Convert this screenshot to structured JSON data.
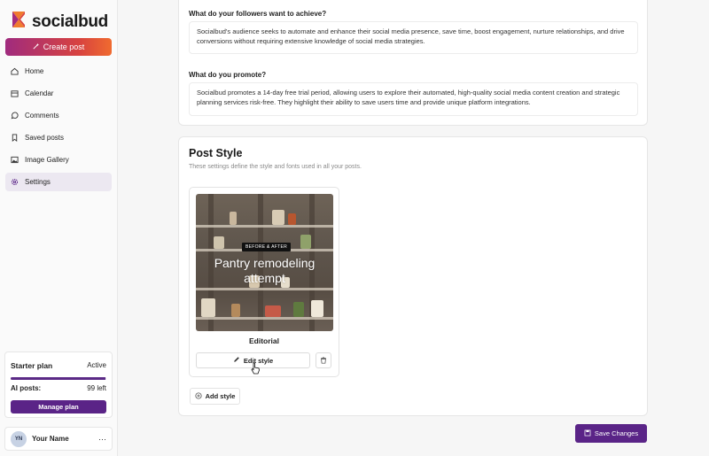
{
  "brand": {
    "name": "socialbud",
    "accent": "#5a2487",
    "gradient": [
      "#a02b7e",
      "#f06b2f"
    ]
  },
  "sidebar": {
    "create_label": "Create post",
    "items": [
      {
        "label": "Home",
        "icon": "home-icon"
      },
      {
        "label": "Calendar",
        "icon": "calendar-icon"
      },
      {
        "label": "Comments",
        "icon": "comment-icon"
      },
      {
        "label": "Saved posts",
        "icon": "bookmark-icon"
      },
      {
        "label": "Image Gallery",
        "icon": "image-icon"
      },
      {
        "label": "Settings",
        "icon": "gear-icon",
        "active": true
      }
    ]
  },
  "plan": {
    "name": "Starter plan",
    "status": "Active",
    "ai_label": "AI posts:",
    "ai_value": "99 left",
    "usage_fraction": 0.99,
    "manage_label": "Manage plan"
  },
  "user": {
    "initials": "YN",
    "name": "Your Name",
    "menu": "···"
  },
  "questions": [
    {
      "label": "What do your followers want to achieve?",
      "answer": "Socialbud's audience seeks to automate and enhance their social media presence, save time, boost engagement, nurture relationships, and drive conversions without requiring extensive knowledge of social media strategies."
    },
    {
      "label": "What do you promote?",
      "answer": "Socialbud promotes a 14-day free trial period, allowing users to explore their automated, high-quality social media content creation and strategic planning services risk-free. They highlight their ability to save users time and provide unique platform integrations."
    }
  ],
  "post_style": {
    "title": "Post Style",
    "subtitle": "These settings define the style and fonts used in all your posts.",
    "styles": [
      {
        "badge": "BEFORE & AFTER",
        "preview_title": "Pantry remodeling attempt",
        "name": "Editorial",
        "edit_label": "Edit style"
      }
    ],
    "add_label": "Add style"
  },
  "save_label": "Save Changes"
}
